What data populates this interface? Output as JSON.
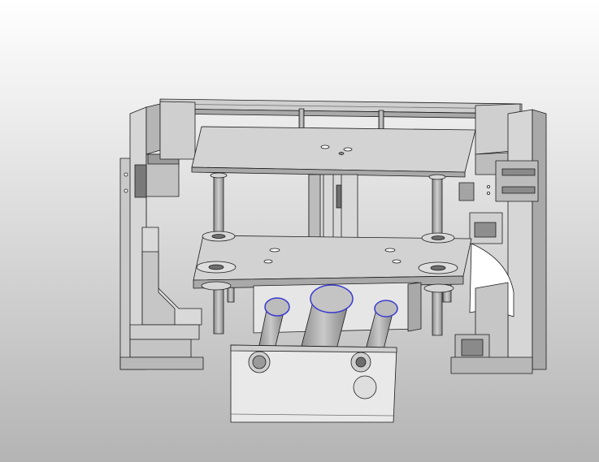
{
  "viewport": {
    "background": {
      "top_color": "#ffffff",
      "bottom_color": "#b4b4b4"
    },
    "model": {
      "face_color": "#d3d3d3",
      "light_face_color": "#e9e9e9",
      "shadow_color": "#a9a9a9",
      "dark_color": "#6e6e6e",
      "edge_color": "#1c1c1c",
      "highlight_edge_color": "#3a3acf"
    }
  }
}
